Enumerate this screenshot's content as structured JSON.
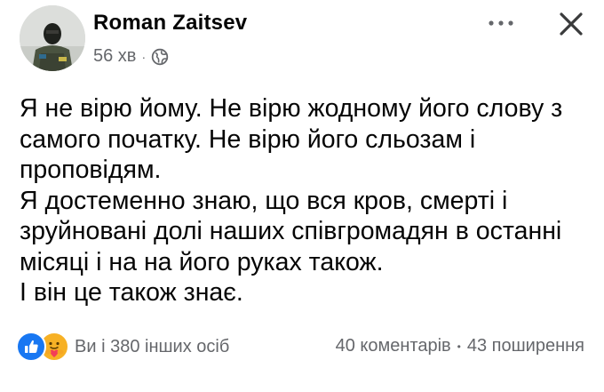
{
  "post": {
    "author": "Roman Zaitsev",
    "time": "56 хв",
    "separator": "·",
    "privacy_icon": "globe-icon",
    "more_icon": "more-options-icon",
    "close_icon": "close-icon",
    "paragraphs": [
      "Я не вірю йому. Не вірю жодному його слову з самого початку. Не вірю його сльозам і проповідям.",
      "Я достеменно знаю, що вся кров, смерті і зруйновані долі наших співгромадян в останні місяці і на на його руках також.",
      "І він це також знає."
    ]
  },
  "footer": {
    "reaction_icons": [
      "like-icon",
      "care-icon"
    ],
    "reactions_text": "Ви і 380 інших осіб",
    "comments": "40 коментарів",
    "separator": "•",
    "shares": "43 поширення"
  },
  "colors": {
    "text": "#050505",
    "secondary": "#65676b",
    "like_blue": "#1877f2",
    "care_yellow": "#f7b125"
  }
}
